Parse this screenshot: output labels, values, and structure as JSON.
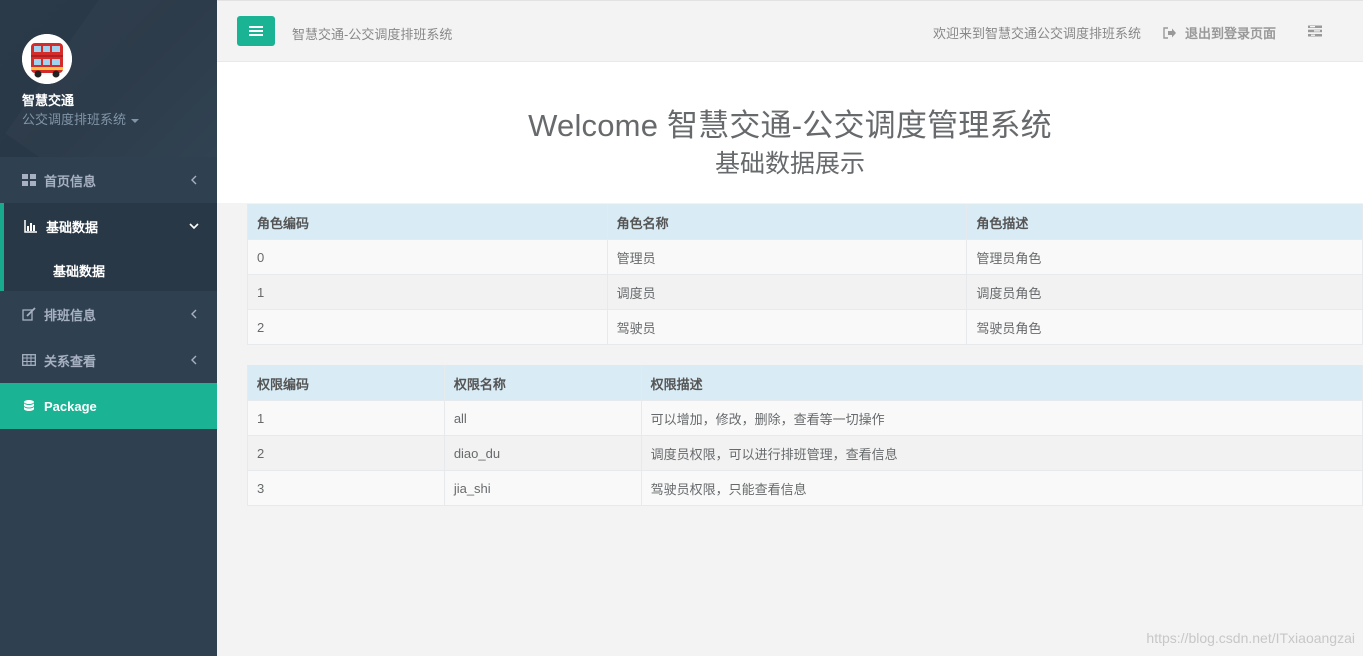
{
  "sidebar": {
    "profile": {
      "name": "智慧交通",
      "role": "公交调度排班系统"
    },
    "items": [
      {
        "label": "首页信息",
        "icon": "dashboard-icon"
      },
      {
        "label": "基础数据",
        "icon": "bar-chart-icon",
        "expanded": true,
        "sub": [
          "基础数据"
        ]
      },
      {
        "label": "排班信息",
        "icon": "edit-icon"
      },
      {
        "label": "关系查看",
        "icon": "table-icon"
      },
      {
        "label": "Package",
        "icon": "database-icon",
        "active": true
      }
    ]
  },
  "topbar": {
    "title": "智慧交通-公交调度排班系统",
    "welcome": "欢迎来到智慧交通公交调度排班系统",
    "logout": "退出到登录页面"
  },
  "hero": {
    "title": "Welcome 智慧交通-公交调度管理系统",
    "subtitle": "基础数据展示"
  },
  "roles_table": {
    "headers": [
      "角色编码",
      "角色名称",
      "角色描述"
    ],
    "rows": [
      [
        "0",
        "管理员",
        "管理员角色"
      ],
      [
        "1",
        "调度员",
        "调度员角色"
      ],
      [
        "2",
        "驾驶员",
        "驾驶员角色"
      ]
    ]
  },
  "permissions_table": {
    "headers": [
      "权限编码",
      "权限名称",
      "权限描述"
    ],
    "rows": [
      [
        "1",
        "all",
        "可以增加，修改，删除，查看等一切操作"
      ],
      [
        "2",
        "diao_du",
        "调度员权限，可以进行排班管理，查看信息"
      ],
      [
        "3",
        "jia_shi",
        "驾驶员权限，只能查看信息"
      ]
    ]
  },
  "watermark": "https://blog.csdn.net/ITxiaoangzai",
  "colors": {
    "sidebar_bg": "#2f4050",
    "accent": "#1ab394",
    "table_header": "#d9ecf5"
  }
}
